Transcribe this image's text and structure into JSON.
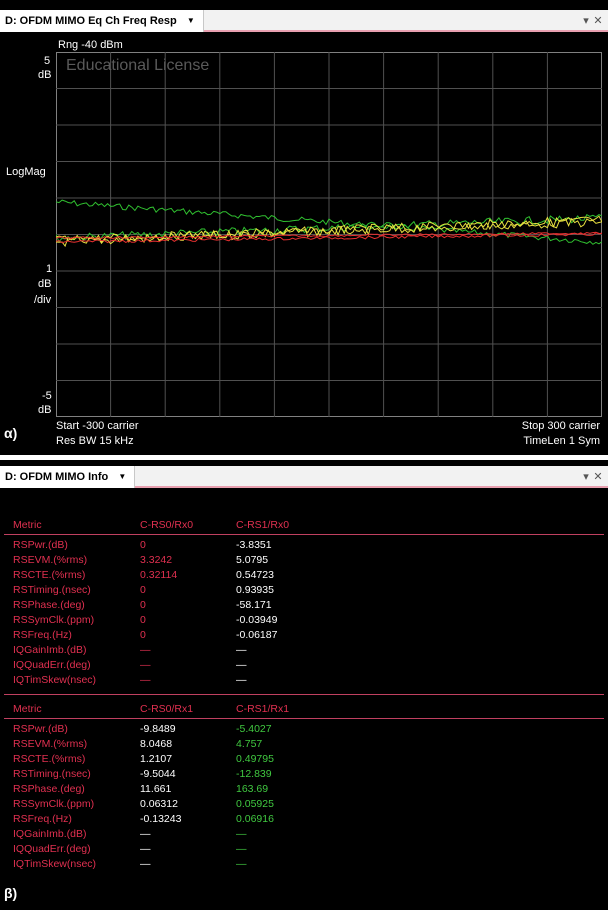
{
  "panel_alpha": {
    "tab_title": "D: OFDM MIMO Eq Ch Freq Resp",
    "corner_label": "α)",
    "range": "Rng -40 dBm",
    "watermark": "Educational License",
    "y_top_value": "5",
    "y_top_unit": "dB",
    "y_mid_label": "LogMag",
    "y_scale_value": "1",
    "y_scale_unit": "dB",
    "y_scale_div": "/div",
    "y_bottom_value": "-5",
    "y_bottom_unit": "dB",
    "start": "Start -300  carrier",
    "res_bw": "Res BW 15 kHz",
    "stop": "Stop 300  carrier",
    "time_len": "TimeLen 1  Sym"
  },
  "panel_beta": {
    "tab_title": "D: OFDM MIMO Info",
    "corner_label": "β)",
    "table1": {
      "headers": [
        "Metric",
        "C-RS0/Rx0",
        "C-RS1/Rx0"
      ],
      "rows": [
        [
          "RSPwr.(dB)",
          "0",
          "-3.8351"
        ],
        [
          "RSEVM.(%rms)",
          "3.3242",
          "5.0795"
        ],
        [
          "RSCTE.(%rms)",
          "0.32114",
          "0.54723"
        ],
        [
          "RSTiming.(nsec)",
          "0",
          "0.93935"
        ],
        [
          "RSPhase.(deg)",
          "0",
          "-58.171"
        ],
        [
          "RSSymClk.(ppm)",
          "0",
          "-0.03949"
        ],
        [
          "RSFreq.(Hz)",
          "0",
          "-0.06187"
        ],
        [
          "IQGainImb.(dB)",
          "—",
          "—"
        ],
        [
          "IQQuadErr.(deg)",
          "—",
          "—"
        ],
        [
          "IQTimSkew(nsec)",
          "—",
          "—"
        ]
      ]
    },
    "table2": {
      "headers": [
        "Metric",
        "C-RS0/Rx1",
        "C-RS1/Rx1"
      ],
      "rows": [
        [
          "RSPwr.(dB)",
          "-9.8489",
          "-5.4027"
        ],
        [
          "RSEVM.(%rms)",
          "8.0468",
          "4.757"
        ],
        [
          "RSCTE.(%rms)",
          "1.2107",
          "0.49795"
        ],
        [
          "RSTiming.(nsec)",
          "-9.5044",
          "-12.839"
        ],
        [
          "RSPhase.(deg)",
          "11.661",
          "163.69"
        ],
        [
          "RSSymClk.(ppm)",
          "0.06312",
          "0.05925"
        ],
        [
          "RSFreq.(Hz)",
          "-0.13243",
          "0.06916"
        ],
        [
          "IQGainImb.(dB)",
          "—",
          "—"
        ],
        [
          "IQQuadErr.(deg)",
          "—",
          "—"
        ],
        [
          "IQTimSkew(nsec)",
          "—",
          "—"
        ]
      ]
    }
  },
  "colors": {
    "red_trace": "#e83030",
    "yellow_trace": "#e8e040",
    "green_trace": "#30c030",
    "label_red": "#e03050",
    "value_white": "#ffffff",
    "value_green": "#40c840",
    "grid": "#505050"
  }
}
